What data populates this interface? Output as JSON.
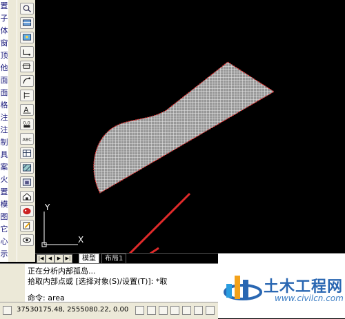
{
  "left_panel_chars": [
    "置",
    "子",
    "体",
    "窗",
    "顶",
    "他",
    "面",
    "面",
    "格",
    "注",
    "注",
    "制",
    "具",
    "案",
    "火",
    "置",
    "模",
    "图",
    "它",
    "心",
    "示"
  ],
  "canvas": {
    "ucs_y_label": "Y",
    "ucs_x_label": "X"
  },
  "layout_tabs": [
    "模型",
    "布局1"
  ],
  "command": {
    "line1": "正在分析内部孤岛...",
    "line2": "拾取内部点或 [选择对象(S)/设置(T)]: *取",
    "prompt": "命令: area"
  },
  "status": {
    "coords": "37530175.48, 2555080.22, 0.00"
  },
  "watermark": {
    "name": "土木工程网",
    "url": "www.civilcn.com"
  },
  "colors": {
    "canvas_bg": "#000000",
    "hatch_fill": "#f2f2f2",
    "boundary": "#e83030",
    "arrow": "#e02a2a",
    "logo_blue": "#2a67b2"
  },
  "icons": [
    "zoom-icon",
    "layers-icon",
    "image-icon",
    "polyline-icon",
    "move-icon",
    "arc-icon",
    "dimension-icon",
    "text-icon",
    "attribute-icon",
    "abc-icon",
    "table-icon",
    "hatch-icon",
    "block-icon",
    "house-icon",
    "palette-icon",
    "edit-icon",
    "eye-icon"
  ]
}
